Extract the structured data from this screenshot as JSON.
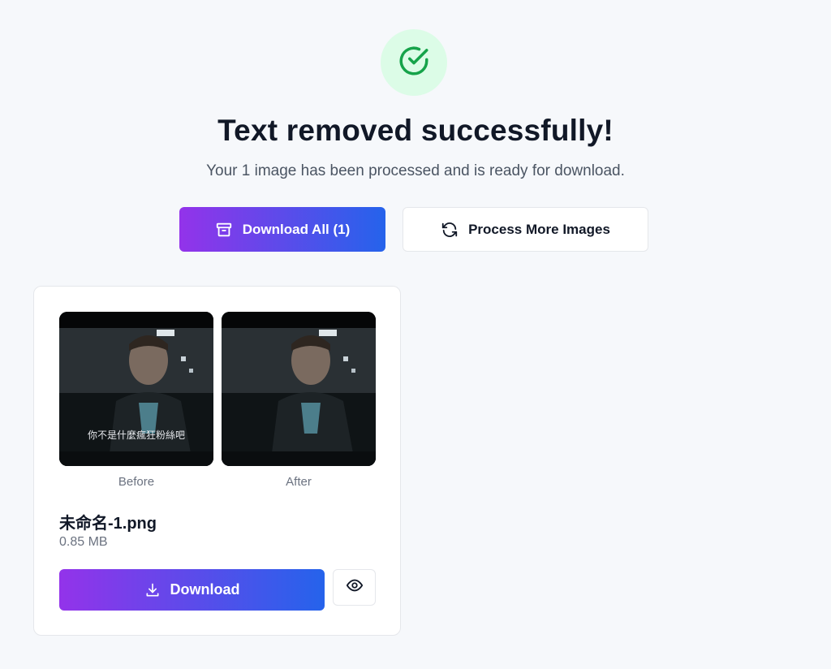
{
  "header": {
    "status_icon": "check-circle-icon",
    "title": "Text removed successfully!",
    "subtitle": "Your 1 image has been processed and is ready for download."
  },
  "actions": {
    "download_all_label": "Download All (1)",
    "download_all_icon": "archive-icon",
    "process_more_label": "Process More Images",
    "process_more_icon": "refresh-icon"
  },
  "result_card": {
    "before_label": "Before",
    "after_label": "After",
    "subtitle_overlay": "你不是什麼瘋狂粉絲吧",
    "file_name": "未命名-1.png",
    "file_size": "0.85 MB",
    "download_label": "Download",
    "download_icon": "download-icon",
    "preview_icon": "eye-icon"
  },
  "colors": {
    "accent_gradient_start": "#9333ea",
    "accent_gradient_end": "#2563eb",
    "success_bg": "#dcfce7",
    "success_fg": "#16a34a"
  }
}
